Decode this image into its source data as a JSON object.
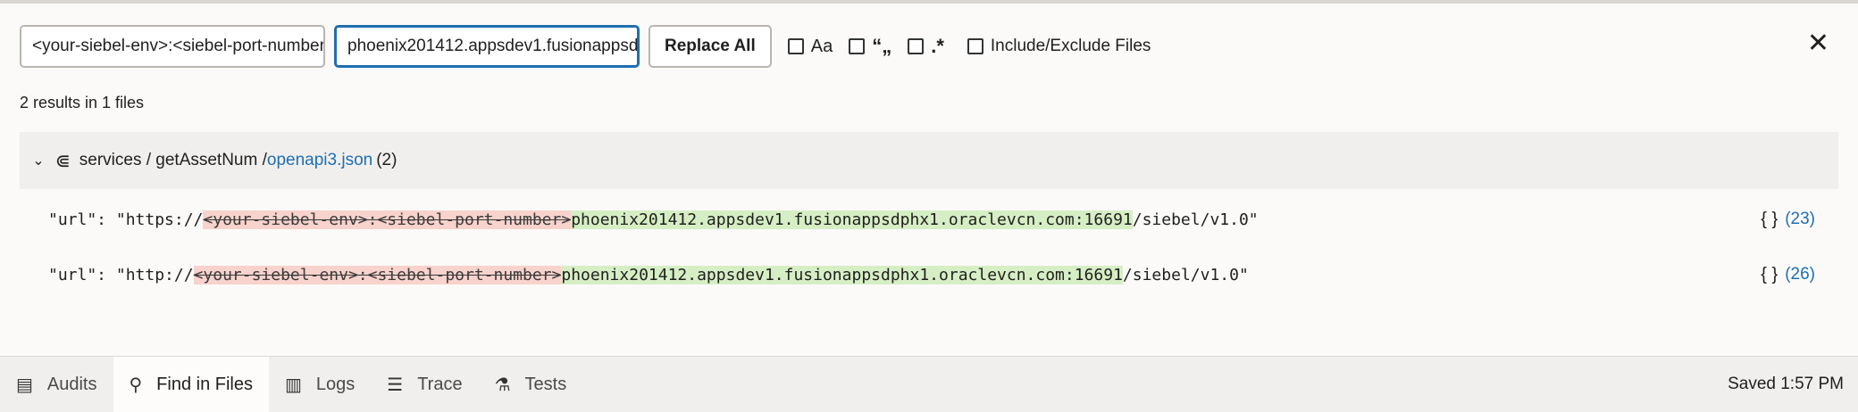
{
  "search": {
    "find_value": "<your-siebel-env>:<siebel-port-number>",
    "replace_value": "phoenix201412.appsdev1.fusionappsdphx1",
    "replace_all_label": "Replace All",
    "options": {
      "match_case_label": "Aa",
      "whole_word_label": "“„",
      "regex_label": ".*",
      "include_exclude_label": "Include/Exclude Files"
    }
  },
  "summary": "2 results in 1 files",
  "file_group": {
    "path": "services / getAssetNum / ",
    "file": "openapi3.json",
    "count": "(2)"
  },
  "results": [
    {
      "prefix": "\"url\": \"https://",
      "deleted": "<your-siebel-env>:<siebel-port-number>",
      "inserted": "phoenix201412.appsdev1.fusionappsdphx1.oraclevcn.com:16691",
      "suffix": "/siebel/v1.0\"",
      "braces": "{ }",
      "line": "(23)"
    },
    {
      "prefix": "\"url\": \"http://",
      "deleted": "<your-siebel-env>:<siebel-port-number>",
      "inserted": "phoenix201412.appsdev1.fusionappsdphx1.oraclevcn.com:16691",
      "suffix": "/siebel/v1.0\"",
      "braces": "{ }",
      "line": "(26)"
    }
  ],
  "tabs": [
    {
      "label": "Audits",
      "icon": "audits-icon"
    },
    {
      "label": "Find in Files",
      "icon": "search-icon"
    },
    {
      "label": "Logs",
      "icon": "logs-icon"
    },
    {
      "label": "Trace",
      "icon": "trace-icon"
    },
    {
      "label": "Tests",
      "icon": "flask-icon"
    }
  ],
  "status": "Saved 1:57 PM",
  "colors": {
    "accent": "#1f6fb0",
    "deleted_bg": "#f8d2cc",
    "inserted_bg": "#d6eec4"
  }
}
